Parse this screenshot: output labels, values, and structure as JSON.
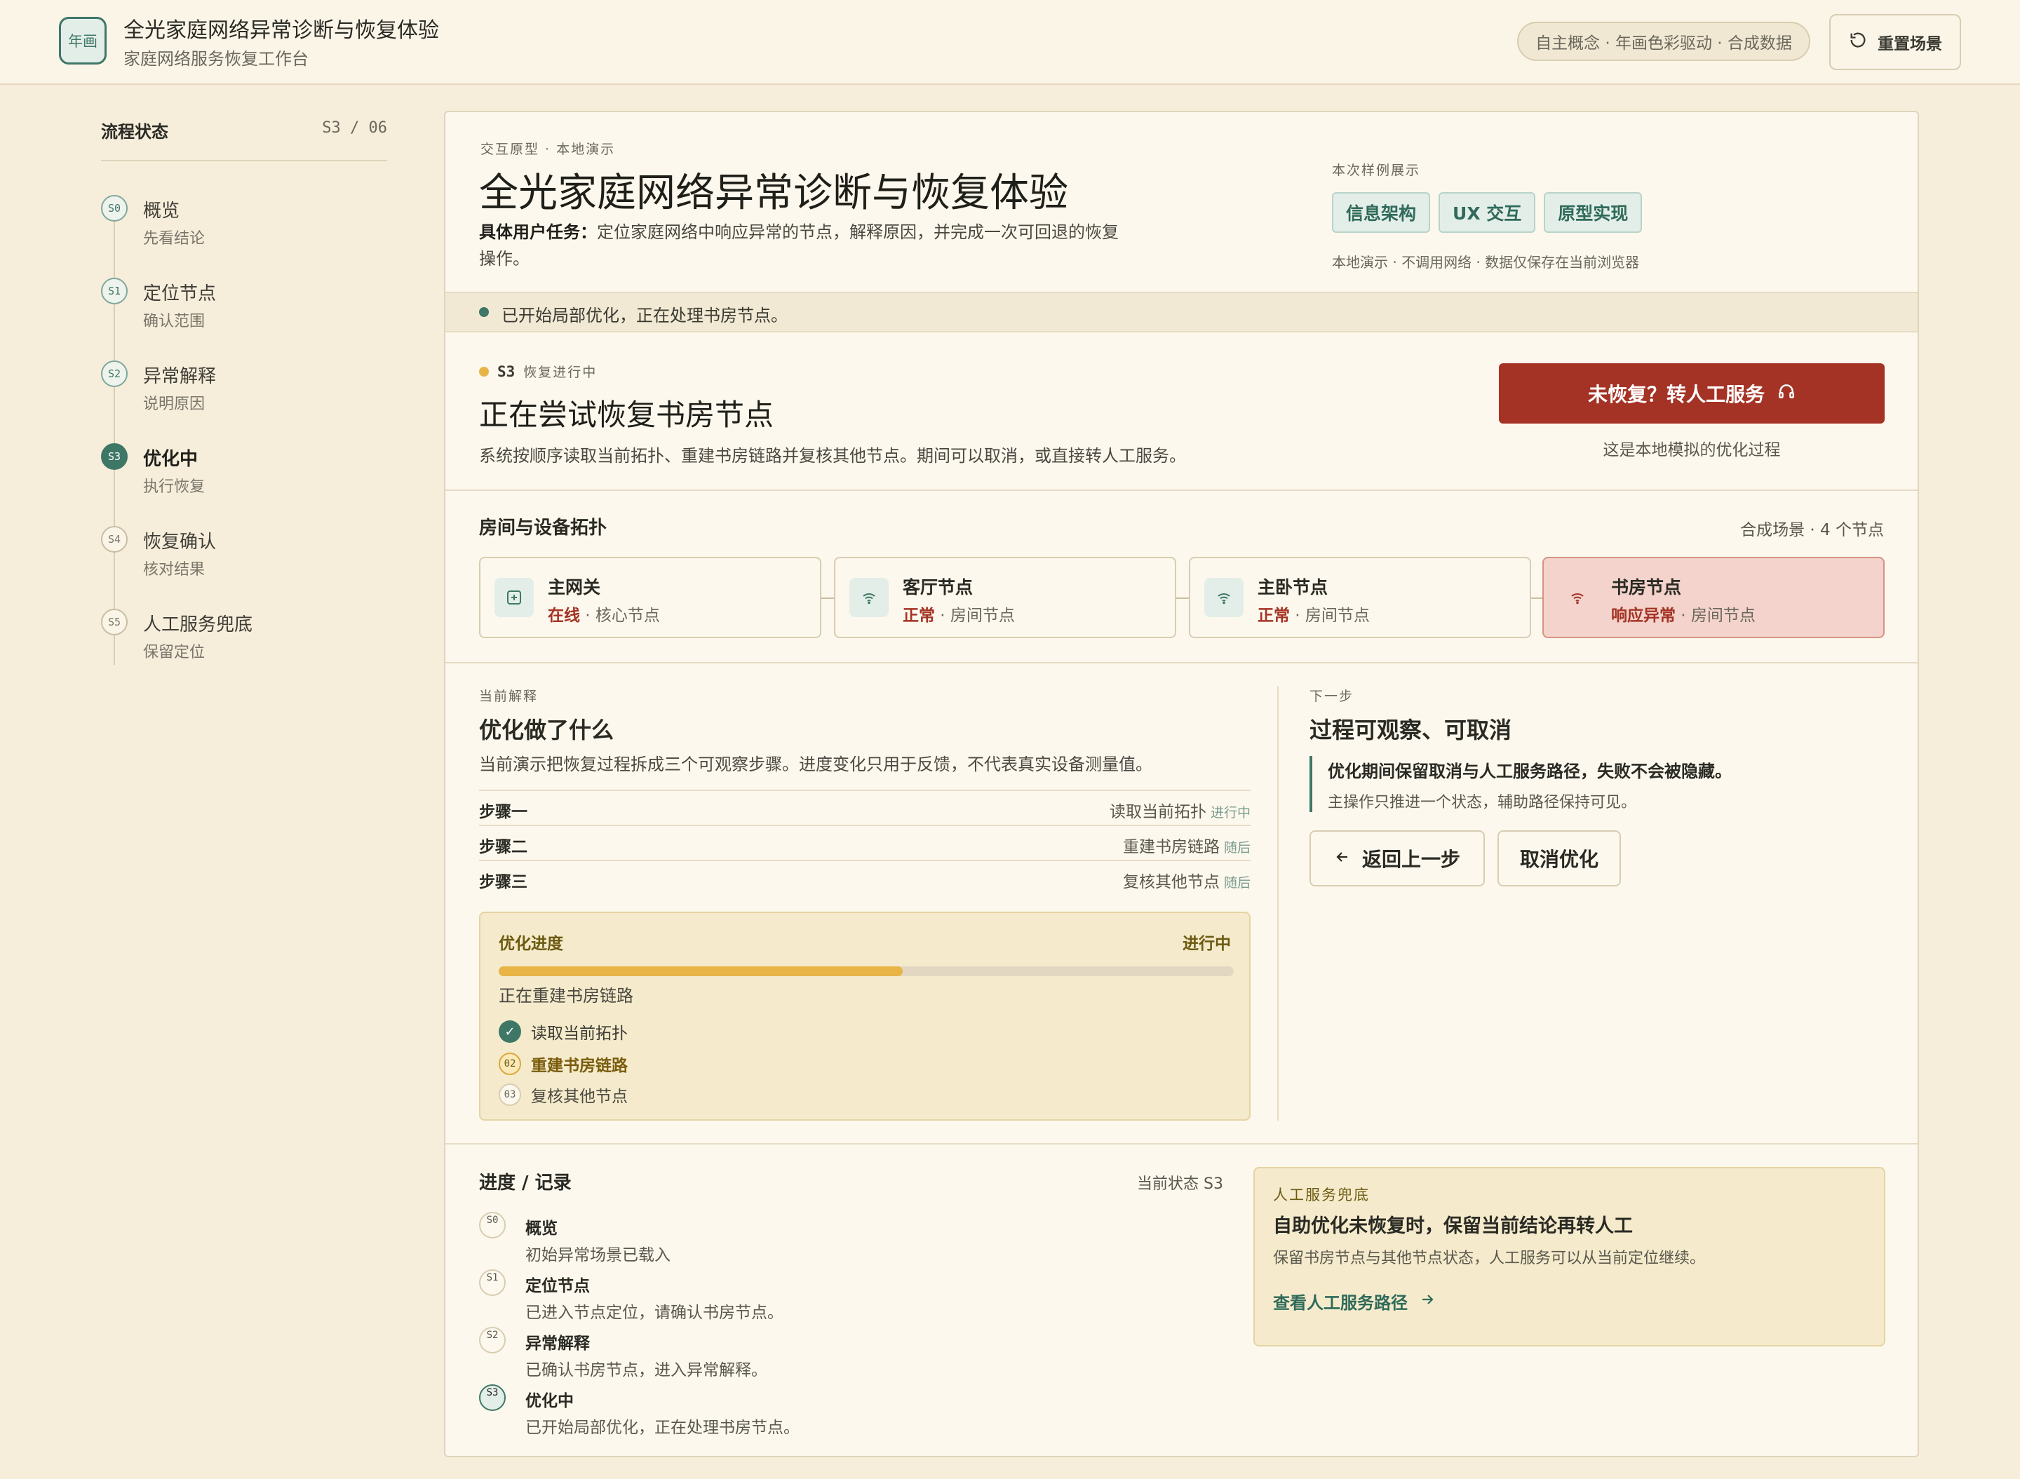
{
  "header": {
    "logo": "年画",
    "title": "全光家庭网络异常诊断与恢复体验",
    "subtitle": "家庭网络服务恢复工作台",
    "concept_pill": "自主概念 · 年画色彩驱动 · 合成数据",
    "reset_label": "重置场景"
  },
  "sidebar": {
    "title": "流程状态",
    "counter": "S3 / 06",
    "steps": [
      {
        "code": "S0",
        "label": "概览",
        "sub": "先看结论"
      },
      {
        "code": "S1",
        "label": "定位节点",
        "sub": "确认范围"
      },
      {
        "code": "S2",
        "label": "异常解释",
        "sub": "说明原因"
      },
      {
        "code": "S3",
        "label": "优化中",
        "sub": "执行恢复"
      },
      {
        "code": "S4",
        "label": "恢复确认",
        "sub": "核对结果"
      },
      {
        "code": "S5",
        "label": "人工服务兜底",
        "sub": "保留定位"
      }
    ]
  },
  "intro": {
    "eyebrow": "交互原型 · 本地演示",
    "title": "全光家庭网络异常诊断与恢复体验",
    "task_label": "具体用户任务：",
    "task_text": "定位家庭网络中响应异常的节点，解释原因，并完成一次可回退的恢复操作。",
    "samples_label": "本次样例展示",
    "chips": [
      "信息架构",
      "UX 交互",
      "原型实现"
    ],
    "note": "本地演示 · 不调用网络 · 数据仅保存在当前浏览器"
  },
  "notice": "已开始局部优化，正在处理书房节点。",
  "status": {
    "code": "S3",
    "tag": "恢复进行中",
    "title": "正在尝试恢复书房节点",
    "desc": "系统按顺序读取当前拓扑、重建书房链路并复核其他节点。期间可以取消，或直接转人工服务。",
    "cta_label": "未恢复？转人工服务",
    "cta_note": "这是本地模拟的优化过程"
  },
  "topology": {
    "title": "房间与设备拓扑",
    "meta": "合成场景 · 4 个节点",
    "nodes": [
      {
        "name": "主网关",
        "state": "在线",
        "role": " · 核心节点",
        "icon": "gateway-icon"
      },
      {
        "name": "客厅节点",
        "state": "正常",
        "role": " · 房间节点",
        "icon": "wifi-icon"
      },
      {
        "name": "主卧节点",
        "state": "正常",
        "role": " · 房间节点",
        "icon": "wifi-icon"
      },
      {
        "name": "书房节点",
        "state": "响应异常",
        "role": " · 房间节点",
        "icon": "wifi-icon"
      }
    ]
  },
  "explain": {
    "eyebrow": "当前解释",
    "title": "优化做了什么",
    "desc": "当前演示把恢复过程拆成三个可观察步骤。进度变化只用于反馈，不代表真实设备测量值。",
    "rows": [
      {
        "k": "步骤一",
        "v": "读取当前拓扑",
        "tag": "进行中"
      },
      {
        "k": "步骤二",
        "v": "重建书房链路",
        "tag": "随后"
      },
      {
        "k": "步骤三",
        "v": "复核其他节点",
        "tag": "随后"
      }
    ]
  },
  "progress": {
    "label": "优化进度",
    "state": "进行中",
    "fraction": 0.55,
    "caption": "正在重建书房链路",
    "items": [
      {
        "marker": "✓",
        "text": "读取当前拓扑"
      },
      {
        "marker": "02",
        "text": "重建书房链路"
      },
      {
        "marker": "03",
        "text": "复核其他节点"
      }
    ]
  },
  "next": {
    "eyebrow": "下一步",
    "title": "过程可观察、可取消",
    "quote_title": "优化期间保留取消与人工服务路径，失败不会被隐藏。",
    "quote_sub": "主操作只推进一个状态，辅助路径保持可见。",
    "back_label": "返回上一步",
    "cancel_label": "取消优化"
  },
  "log": {
    "title": "进度 / 记录",
    "current": "当前状态 S3",
    "entries": [
      {
        "code": "S0",
        "title": "概览",
        "sub": "初始异常场景已载入"
      },
      {
        "code": "S1",
        "title": "定位节点",
        "sub": "已进入节点定位，请确认书房节点。"
      },
      {
        "code": "S2",
        "title": "异常解释",
        "sub": "已确认书房节点，进入异常解释。"
      },
      {
        "code": "S3",
        "title": "优化中",
        "sub": "已开始局部优化，正在处理书房节点。"
      }
    ]
  },
  "support": {
    "eyebrow": "人工服务兜底",
    "title": "自助优化未恢复时，保留当前结论再转人工",
    "desc": "保留书房节点与其他节点状态，人工服务可以从当前定位继续。",
    "link": "查看人工服务路径"
  },
  "colors": {
    "accent": "#3f7767",
    "danger": "#a43325",
    "progress": "#e8b446",
    "background": "#f6eddb"
  }
}
